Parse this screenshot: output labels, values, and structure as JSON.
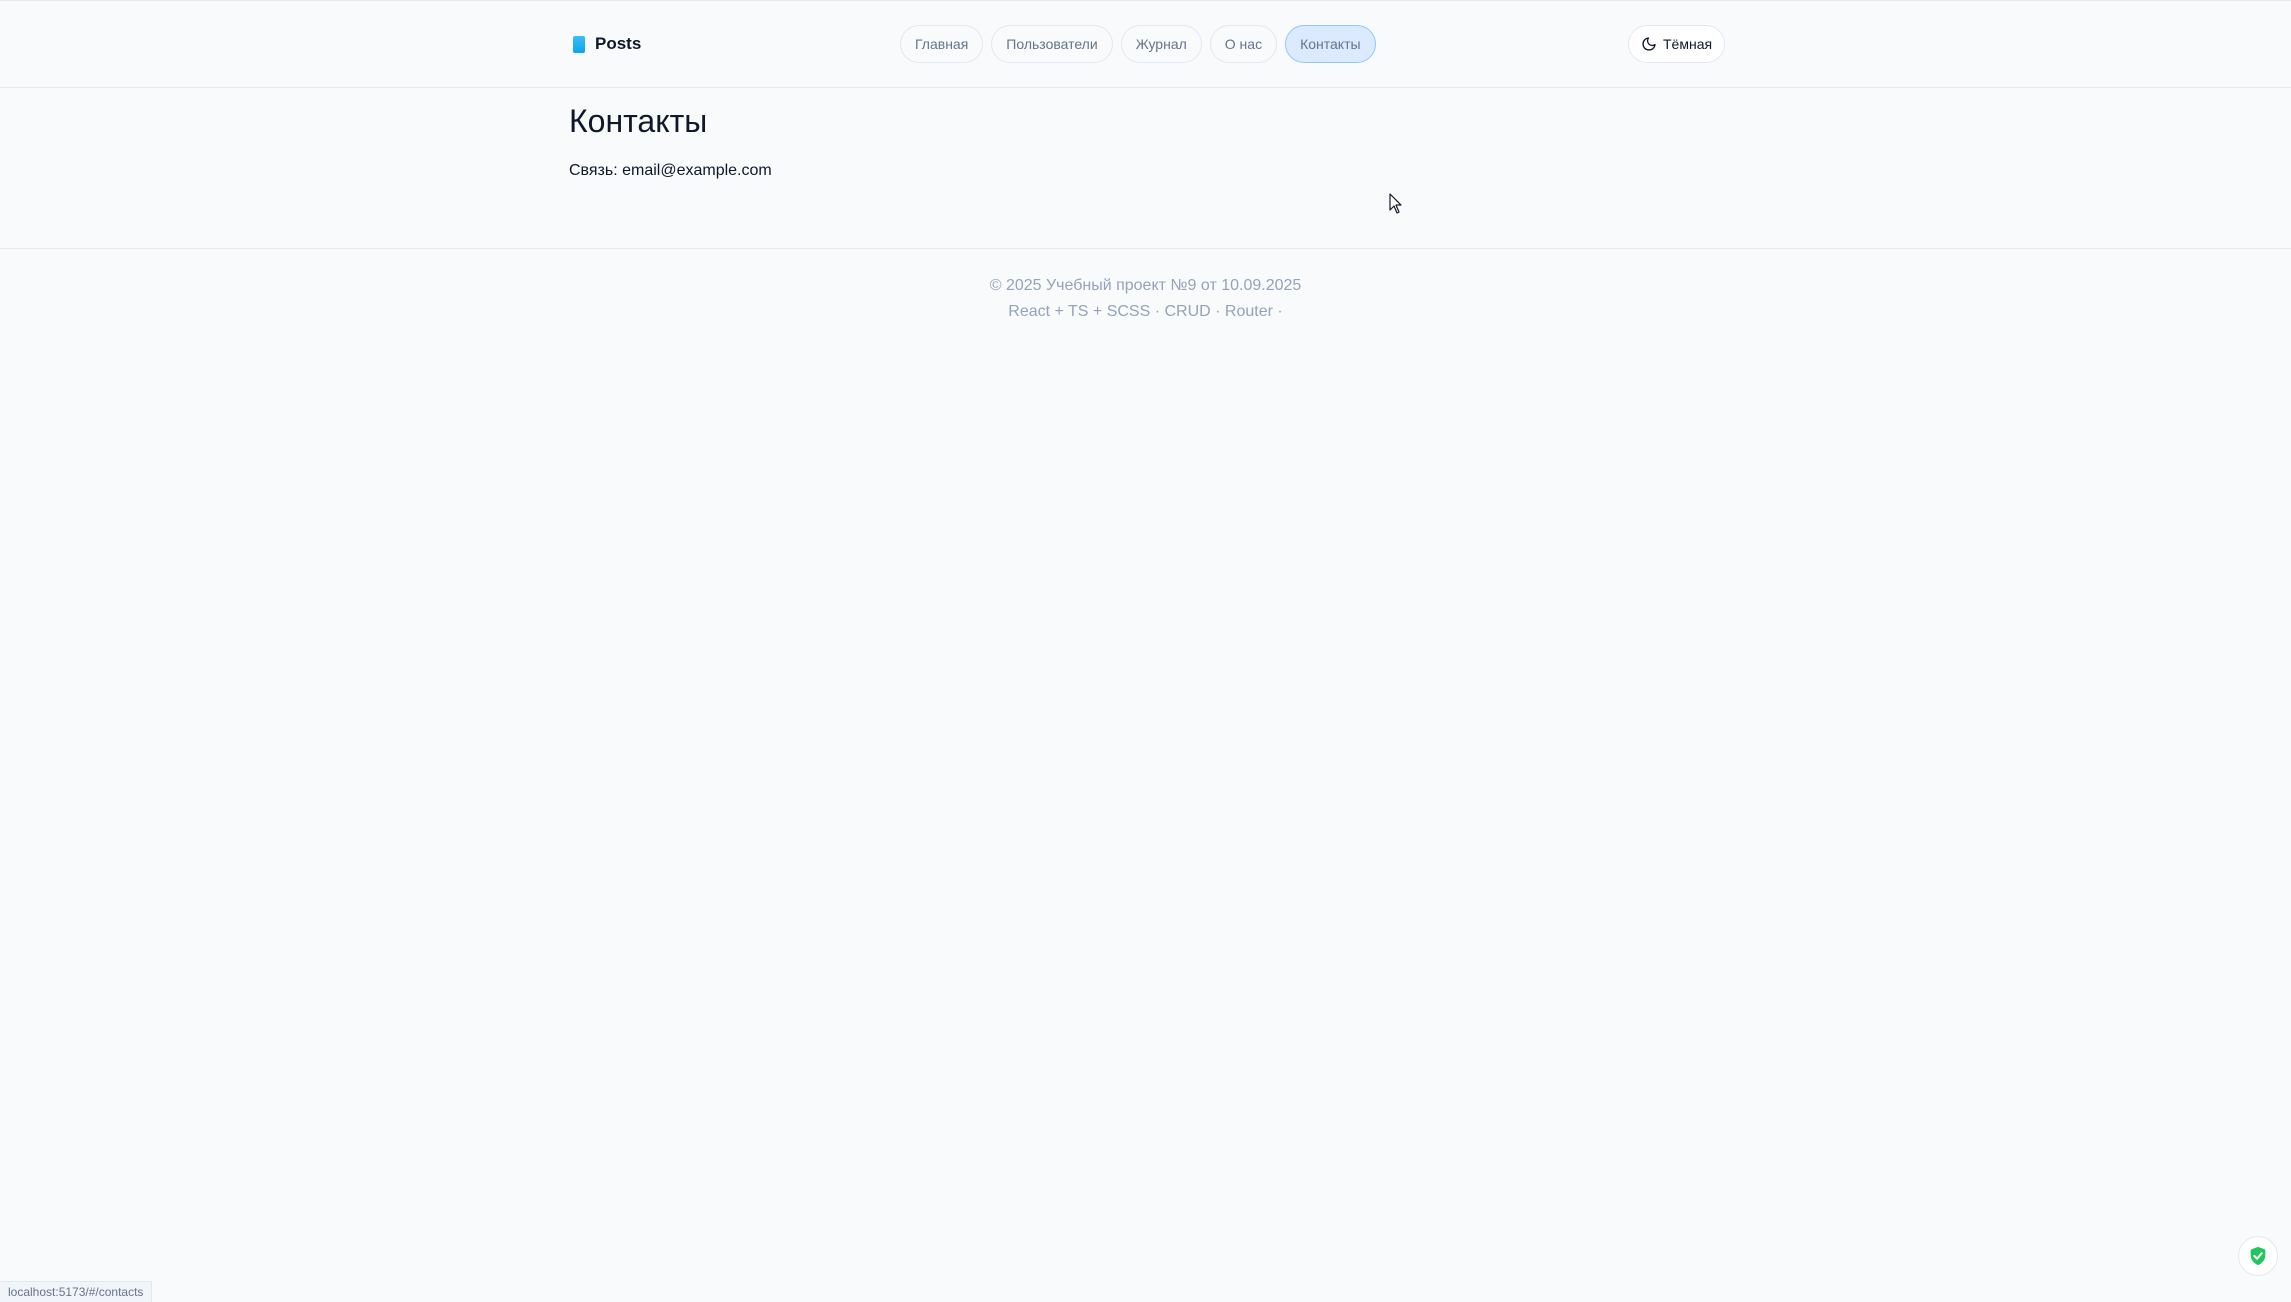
{
  "brand": {
    "name": "Posts"
  },
  "nav": {
    "items": [
      {
        "label": "Главная"
      },
      {
        "label": "Пользователи"
      },
      {
        "label": "Журнал"
      },
      {
        "label": "О нас"
      },
      {
        "label": "Контакты",
        "active": true
      }
    ]
  },
  "theme_toggle": {
    "label": "Тёмная",
    "icon": "moon-icon"
  },
  "main": {
    "title": "Контакты",
    "contact_text": "Связь: email@example.com"
  },
  "footer": {
    "line1": "© 2025 Учебный проект №9 от 10.09.2025",
    "line2": "React + TS + SCSS · CRUD · Router ·"
  },
  "status_bar": {
    "url": "localhost:5173/#/contacts"
  },
  "colors": {
    "background": "#f8fafc",
    "active_pill": "#dbeafe",
    "active_pill_border": "#93c5fd",
    "muted_text": "#94a3b8",
    "shield_green": "#22c55e"
  }
}
